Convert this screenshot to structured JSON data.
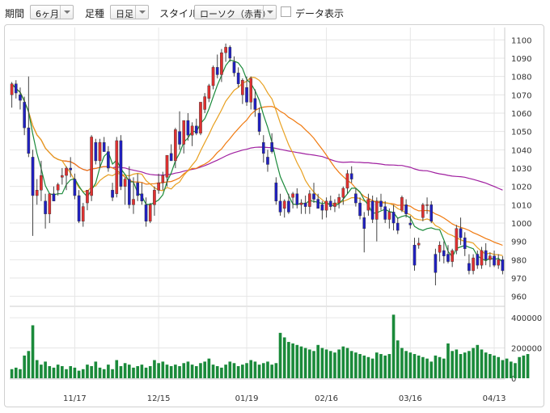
{
  "toolbar": {
    "period_label": "期間",
    "period_value": "6ヶ月",
    "foot_label": "足種",
    "foot_value": "日足",
    "style_label": "スタイル",
    "style_value": "ローソク（赤青）",
    "data_display_label": "データ表示"
  },
  "colors": {
    "up": "#e03030",
    "down": "#2020c0",
    "volume": "#1a8a3a",
    "ma_short": "#1a8a3a",
    "ma_mid": "#e8a020",
    "ma_long": "#f07a10",
    "ma_longest": "#a020a0"
  },
  "chart_data": [
    {
      "type": "candlestick",
      "x_tick_labels": [
        "11/17",
        "12/15",
        "01/19",
        "02/16",
        "03/16",
        "04/13"
      ],
      "y_ticks": [
        960,
        970,
        980,
        990,
        1000,
        1010,
        1020,
        1030,
        1040,
        1050,
        1060,
        1070,
        1080,
        1090,
        1100
      ],
      "ylim": [
        955,
        1105
      ],
      "grid": true,
      "candles": [
        {
          "o": 1070,
          "h": 1077,
          "l": 1063,
          "c": 1076
        },
        {
          "o": 1076,
          "h": 1078,
          "l": 1068,
          "c": 1071
        },
        {
          "o": 1070,
          "h": 1074,
          "l": 1062,
          "c": 1067
        },
        {
          "o": 1066,
          "h": 1069,
          "l": 1048,
          "c": 1052
        },
        {
          "o": 1052,
          "h": 1080,
          "l": 1036,
          "c": 1038
        },
        {
          "o": 1036,
          "h": 1040,
          "l": 993,
          "c": 1015
        },
        {
          "o": 1015,
          "h": 1024,
          "l": 1010,
          "c": 1018
        },
        {
          "o": 1018,
          "h": 1034,
          "l": 1012,
          "c": 1026
        },
        {
          "o": 1012,
          "h": 1016,
          "l": 997,
          "c": 1005
        },
        {
          "o": 1005,
          "h": 1016,
          "l": 1000,
          "c": 1016
        },
        {
          "o": 1016,
          "h": 1020,
          "l": 1012,
          "c": 1012
        },
        {
          "o": 1018,
          "h": 1022,
          "l": 1015,
          "c": 1021
        },
        {
          "o": 1025,
          "h": 1030,
          "l": 1021,
          "c": 1026
        },
        {
          "o": 1026,
          "h": 1031,
          "l": 1018,
          "c": 1030
        },
        {
          "o": 1030,
          "h": 1036,
          "l": 1025,
          "c": 1029
        },
        {
          "o": 1024,
          "h": 1027,
          "l": 1013,
          "c": 1015
        },
        {
          "o": 1015,
          "h": 1018,
          "l": 1000,
          "c": 1001
        },
        {
          "o": 1001,
          "h": 1011,
          "l": 998,
          "c": 1009
        },
        {
          "o": 1011,
          "h": 1018,
          "l": 1007,
          "c": 1018
        },
        {
          "o": 1015,
          "h": 1048,
          "l": 1012,
          "c": 1047
        },
        {
          "o": 1044,
          "h": 1046,
          "l": 1032,
          "c": 1034
        },
        {
          "o": 1034,
          "h": 1046,
          "l": 1030,
          "c": 1044
        },
        {
          "o": 1044,
          "h": 1047,
          "l": 1039,
          "c": 1039
        },
        {
          "o": 1039,
          "h": 1042,
          "l": 1028,
          "c": 1030
        },
        {
          "o": 1018,
          "h": 1022,
          "l": 1012,
          "c": 1014
        },
        {
          "o": 1016,
          "h": 1047,
          "l": 1014,
          "c": 1045
        },
        {
          "o": 1045,
          "h": 1048,
          "l": 1018,
          "c": 1020
        },
        {
          "o": 1020,
          "h": 1025,
          "l": 1010,
          "c": 1024
        },
        {
          "o": 1024,
          "h": 1031,
          "l": 1008,
          "c": 1010
        },
        {
          "o": 1010,
          "h": 1025,
          "l": 1005,
          "c": 1013
        },
        {
          "o": 1022,
          "h": 1027,
          "l": 1012,
          "c": 1015
        },
        {
          "o": 1016,
          "h": 1022,
          "l": 1010,
          "c": 1012
        },
        {
          "o": 1010,
          "h": 1014,
          "l": 998,
          "c": 1001
        },
        {
          "o": 1001,
          "h": 1011,
          "l": 1000,
          "c": 1010
        },
        {
          "o": 1010,
          "h": 1020,
          "l": 1004,
          "c": 1018
        },
        {
          "o": 1018,
          "h": 1027,
          "l": 1016,
          "c": 1022
        },
        {
          "o": 1022,
          "h": 1028,
          "l": 1018,
          "c": 1026
        },
        {
          "o": 1025,
          "h": 1037,
          "l": 1020,
          "c": 1037
        },
        {
          "o": 1038,
          "h": 1043,
          "l": 1034,
          "c": 1034
        },
        {
          "o": 1034,
          "h": 1052,
          "l": 1030,
          "c": 1051
        },
        {
          "o": 1050,
          "h": 1061,
          "l": 1040,
          "c": 1043
        },
        {
          "o": 1043,
          "h": 1056,
          "l": 1038,
          "c": 1056
        },
        {
          "o": 1056,
          "h": 1060,
          "l": 1045,
          "c": 1048
        },
        {
          "o": 1048,
          "h": 1055,
          "l": 1042,
          "c": 1053
        },
        {
          "o": 1053,
          "h": 1057,
          "l": 1048,
          "c": 1049
        },
        {
          "o": 1049,
          "h": 1066,
          "l": 1048,
          "c": 1066
        },
        {
          "o": 1062,
          "h": 1071,
          "l": 1060,
          "c": 1069
        },
        {
          "o": 1068,
          "h": 1076,
          "l": 1066,
          "c": 1075
        },
        {
          "o": 1075,
          "h": 1086,
          "l": 1073,
          "c": 1085
        },
        {
          "o": 1085,
          "h": 1092,
          "l": 1079,
          "c": 1081
        },
        {
          "o": 1081,
          "h": 1095,
          "l": 1077,
          "c": 1093
        },
        {
          "o": 1093,
          "h": 1098,
          "l": 1088,
          "c": 1096
        },
        {
          "o": 1096,
          "h": 1097,
          "l": 1088,
          "c": 1090
        },
        {
          "o": 1088,
          "h": 1091,
          "l": 1080,
          "c": 1082
        },
        {
          "o": 1082,
          "h": 1085,
          "l": 1074,
          "c": 1076
        },
        {
          "o": 1070,
          "h": 1079,
          "l": 1065,
          "c": 1078
        },
        {
          "o": 1074,
          "h": 1080,
          "l": 1064,
          "c": 1066
        },
        {
          "o": 1066,
          "h": 1080,
          "l": 1062,
          "c": 1079
        },
        {
          "o": 1068,
          "h": 1073,
          "l": 1058,
          "c": 1062
        },
        {
          "o": 1060,
          "h": 1063,
          "l": 1048,
          "c": 1050
        },
        {
          "o": 1044,
          "h": 1048,
          "l": 1033,
          "c": 1038
        },
        {
          "o": 1036,
          "h": 1040,
          "l": 1028,
          "c": 1032
        },
        {
          "o": 1044,
          "h": 1049,
          "l": 1038,
          "c": 1039
        },
        {
          "o": 1022,
          "h": 1025,
          "l": 1010,
          "c": 1012
        },
        {
          "o": 1012,
          "h": 1016,
          "l": 1004,
          "c": 1006
        },
        {
          "o": 1008,
          "h": 1013,
          "l": 1003,
          "c": 1012
        },
        {
          "o": 1012,
          "h": 1016,
          "l": 1005,
          "c": 1006
        },
        {
          "o": 1014,
          "h": 1017,
          "l": 1008,
          "c": 1016
        },
        {
          "o": 1016,
          "h": 1019,
          "l": 1008,
          "c": 1010
        },
        {
          "o": 1010,
          "h": 1013,
          "l": 1005,
          "c": 1011
        },
        {
          "o": 1011,
          "h": 1015,
          "l": 1005,
          "c": 1009
        },
        {
          "o": 1009,
          "h": 1018,
          "l": 1005,
          "c": 1016
        },
        {
          "o": 1016,
          "h": 1022,
          "l": 1011,
          "c": 1013
        },
        {
          "o": 1013,
          "h": 1016,
          "l": 1008,
          "c": 1008
        },
        {
          "o": 1010,
          "h": 1012,
          "l": 1002,
          "c": 1007
        },
        {
          "o": 1007,
          "h": 1014,
          "l": 1003,
          "c": 1012
        },
        {
          "o": 1012,
          "h": 1015,
          "l": 1007,
          "c": 1009
        },
        {
          "o": 1009,
          "h": 1013,
          "l": 1006,
          "c": 1011
        },
        {
          "o": 1011,
          "h": 1016,
          "l": 1008,
          "c": 1014
        },
        {
          "o": 1014,
          "h": 1020,
          "l": 1010,
          "c": 1019
        },
        {
          "o": 1019,
          "h": 1029,
          "l": 1016,
          "c": 1027
        },
        {
          "o": 1027,
          "h": 1031,
          "l": 1022,
          "c": 1024
        },
        {
          "o": 1016,
          "h": 1019,
          "l": 1009,
          "c": 1011
        },
        {
          "o": 1011,
          "h": 1014,
          "l": 1002,
          "c": 1004
        },
        {
          "o": 1003,
          "h": 1006,
          "l": 984,
          "c": 997
        },
        {
          "o": 1007,
          "h": 1016,
          "l": 1004,
          "c": 1013
        },
        {
          "o": 1012,
          "h": 1015,
          "l": 1000,
          "c": 1002
        },
        {
          "o": 1002,
          "h": 1014,
          "l": 990,
          "c": 1012
        },
        {
          "o": 1012,
          "h": 1016,
          "l": 1007,
          "c": 1009
        },
        {
          "o": 1009,
          "h": 1012,
          "l": 1000,
          "c": 1002
        },
        {
          "o": 1002,
          "h": 1008,
          "l": 997,
          "c": 1006
        },
        {
          "o": 1006,
          "h": 1010,
          "l": 996,
          "c": 1000
        },
        {
          "o": 1000,
          "h": 1003,
          "l": 994,
          "c": 996
        },
        {
          "o": 1007,
          "h": 1015,
          "l": 1006,
          "c": 1014
        },
        {
          "o": 1010,
          "h": 1013,
          "l": 1003,
          "c": 1005
        },
        {
          "o": 1000,
          "h": 1004,
          "l": 997,
          "c": 999
        },
        {
          "o": 988,
          "h": 992,
          "l": 974,
          "c": 977
        },
        {
          "o": 988,
          "h": 992,
          "l": 986,
          "c": 989
        },
        {
          "o": 1003,
          "h": 1011,
          "l": 1001,
          "c": 1010
        },
        {
          "o": 1010,
          "h": 1014,
          "l": 1005,
          "c": 1010
        },
        {
          "o": 1010,
          "h": 1012,
          "l": 1000,
          "c": 1001
        },
        {
          "o": 983,
          "h": 986,
          "l": 966,
          "c": 973
        },
        {
          "o": 984,
          "h": 990,
          "l": 979,
          "c": 988
        },
        {
          "o": 985,
          "h": 990,
          "l": 978,
          "c": 982
        },
        {
          "o": 983,
          "h": 988,
          "l": 978,
          "c": 979
        },
        {
          "o": 979,
          "h": 986,
          "l": 976,
          "c": 985
        },
        {
          "o": 985,
          "h": 999,
          "l": 983,
          "c": 997
        },
        {
          "o": 997,
          "h": 1003,
          "l": 988,
          "c": 992
        },
        {
          "o": 992,
          "h": 995,
          "l": 982,
          "c": 986
        },
        {
          "o": 978,
          "h": 983,
          "l": 972,
          "c": 974
        },
        {
          "o": 974,
          "h": 983,
          "l": 972,
          "c": 981
        },
        {
          "o": 983,
          "h": 985,
          "l": 975,
          "c": 977
        },
        {
          "o": 977,
          "h": 987,
          "l": 975,
          "c": 985
        },
        {
          "o": 985,
          "h": 989,
          "l": 977,
          "c": 980
        },
        {
          "o": 980,
          "h": 984,
          "l": 976,
          "c": 982
        },
        {
          "o": 982,
          "h": 985,
          "l": 976,
          "c": 977
        },
        {
          "o": 977,
          "h": 983,
          "l": 975,
          "c": 980
        },
        {
          "o": 980,
          "h": 982,
          "l": 972,
          "c": 974
        }
      ]
    },
    {
      "type": "bar",
      "y_ticks": [
        0,
        200000,
        400000
      ],
      "ylim": [
        0,
        470000
      ],
      "grid": true,
      "values": [
        60000,
        70000,
        60000,
        150000,
        180000,
        350000,
        120000,
        90000,
        110000,
        80000,
        70000,
        90000,
        80000,
        60000,
        80000,
        70000,
        50000,
        60000,
        90000,
        80000,
        110000,
        70000,
        60000,
        90000,
        60000,
        120000,
        80000,
        100000,
        90000,
        70000,
        80000,
        90000,
        70000,
        80000,
        120000,
        100000,
        110000,
        90000,
        80000,
        90000,
        80000,
        100000,
        110000,
        90000,
        80000,
        100000,
        110000,
        130000,
        90000,
        80000,
        70000,
        90000,
        110000,
        100000,
        80000,
        90000,
        100000,
        120000,
        110000,
        90000,
        100000,
        110000,
        90000,
        100000,
        300000,
        270000,
        240000,
        230000,
        220000,
        210000,
        200000,
        190000,
        180000,
        220000,
        200000,
        190000,
        180000,
        170000,
        190000,
        210000,
        200000,
        180000,
        170000,
        160000,
        150000,
        140000,
        130000,
        170000,
        160000,
        150000,
        160000,
        420000,
        250000,
        200000,
        180000,
        170000,
        160000,
        150000,
        140000,
        130000,
        110000,
        150000,
        140000,
        130000,
        230000,
        180000,
        190000,
        160000,
        170000,
        180000,
        200000,
        220000,
        190000,
        170000,
        160000,
        150000,
        140000,
        120000,
        130000,
        110000,
        100000,
        140000,
        150000,
        160000
      ]
    }
  ]
}
